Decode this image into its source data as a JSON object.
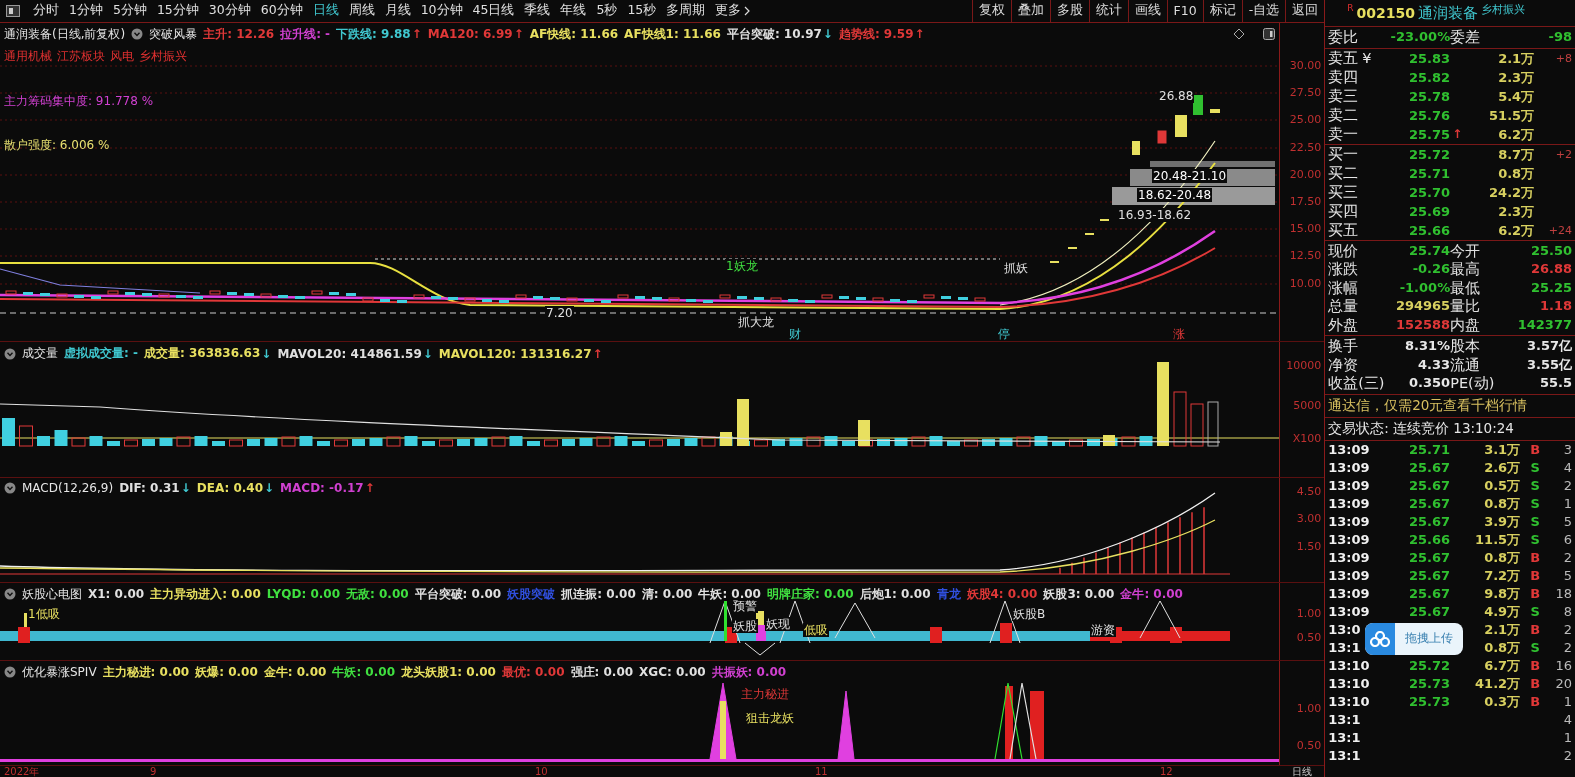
{
  "toolbar": {
    "periods": [
      {
        "label": "分时",
        "selected": false
      },
      {
        "label": "1分钟",
        "selected": false
      },
      {
        "label": "5分钟",
        "selected": false
      },
      {
        "label": "15分钟",
        "selected": false
      },
      {
        "label": "30分钟",
        "selected": false
      },
      {
        "label": "60分钟",
        "selected": false
      },
      {
        "label": "日线",
        "selected": true
      },
      {
        "label": "周线",
        "selected": false
      },
      {
        "label": "月线",
        "selected": false
      },
      {
        "label": "10分钟",
        "selected": false
      },
      {
        "label": "45日线",
        "selected": false
      },
      {
        "label": "季线",
        "selected": false
      },
      {
        "label": "年线",
        "selected": false
      },
      {
        "label": "5秒",
        "selected": false
      },
      {
        "label": "15秒",
        "selected": false
      },
      {
        "label": "多周期",
        "selected": false
      }
    ],
    "more": "更多",
    "actions": [
      "复权",
      "叠加",
      "多股",
      "统计",
      "画线",
      "F10",
      "标记",
      "-自选",
      "返回"
    ]
  },
  "panels": [
    {
      "kind": "price",
      "title": "通润装备(日线,前复权)",
      "indicator": "突破风暴",
      "items": [
        {
          "text": "主升: 12.26",
          "color": "#e03838"
        },
        {
          "text": "拉升线: -",
          "color": "#d040d0"
        },
        {
          "text": "下跌线: 9.88",
          "color": "#40c8d0",
          "arrow": "↑",
          "rising": true
        },
        {
          "text": "MA120: 6.99",
          "color": "#e03838",
          "arrow": "↑",
          "rising": true
        },
        {
          "text": "AF快线: 11.66",
          "color": "#e8e060"
        },
        {
          "text": "AF快线1: 11.66",
          "color": "#e8e060"
        },
        {
          "text": "平台突破: 10.97",
          "color": "#e0e0e0",
          "arrow": "↓",
          "rising": false
        },
        {
          "text": "趋势线: 9.59",
          "color": "#e03838",
          "arrow": "↑",
          "rising": true
        }
      ],
      "tags": [
        "通用机械",
        "江苏板块",
        "风电",
        "乡村振兴"
      ],
      "notes": [
        {
          "text": "主力筹码集中度: 91.778  %",
          "color": "#d040d0"
        },
        {
          "text": "散户强度: 6.006 %",
          "color": "#e8e070"
        }
      ],
      "axis": [
        "30.00",
        "27.50",
        "25.00",
        "22.50",
        "20.00",
        "17.50",
        "15.00",
        "12.50",
        "10.00"
      ],
      "annotations": [
        "26.88",
        "20.48-21.10",
        "18.62-20.48",
        "16.93-18.62",
        "7.20",
        "1妖龙",
        "抓妖",
        "抓大龙",
        "财",
        "停",
        "涨"
      ]
    },
    {
      "kind": "volume",
      "title": "成交量",
      "items": [
        {
          "text": "虚拟成交量: -",
          "color": "#40c8d0"
        },
        {
          "text": "成交量: 363836.63",
          "color": "#e8e060",
          "arrow": "↓",
          "rising": false
        },
        {
          "text": "MAVOL20: 414861.59",
          "color": "#e0e0e0",
          "arrow": "↓",
          "rising": false
        },
        {
          "text": "MAVOL120: 131316.27",
          "color": "#e8e060",
          "arrow": "↑",
          "rising": true
        }
      ],
      "axis": [
        "10000",
        "5000",
        "X100"
      ]
    },
    {
      "kind": "macd",
      "title": "MACD(12,26,9)",
      "items": [
        {
          "text": "DIF: 0.31",
          "color": "#e0e0e0",
          "arrow": "↓",
          "rising": false
        },
        {
          "text": "DEA: 0.40",
          "color": "#e8e060",
          "arrow": "↓",
          "rising": false
        },
        {
          "text": "MACD: -0.17",
          "color": "#d040d0",
          "arrow": "↑",
          "rising": true
        }
      ],
      "axis": [
        "4.50",
        "3.00",
        "1.50"
      ]
    },
    {
      "kind": "signal",
      "title": "妖股心电图",
      "items": [
        {
          "text": "X1: 0.00",
          "color": "#e0e0e0"
        },
        {
          "text": "主力异动进入: 0.00",
          "color": "#e8e060"
        },
        {
          "text": "LYQD: 0.00",
          "color": "#40e040"
        },
        {
          "text": "无敌: 0.00",
          "color": "#40e040"
        },
        {
          "text": "平台突破: 0.00",
          "color": "#e0e0e0"
        },
        {
          "text": "妖股突破",
          "color": "#3050e0"
        },
        {
          "text": "抓连振: 0.00",
          "color": "#e0e0e0"
        },
        {
          "text": "清: 0.00",
          "color": "#e0e0e0"
        },
        {
          "text": "牛妖: 0.00",
          "color": "#e0e0e0"
        },
        {
          "text": "明牌庄家: 0.00",
          "color": "#40e040"
        },
        {
          "text": "后炮1: 0.00",
          "color": "#e0e0e0"
        },
        {
          "text": "青龙",
          "color": "#3050e0"
        },
        {
          "text": "妖股4: 0.00",
          "color": "#e03838"
        },
        {
          "text": "妖股3: 0.00",
          "color": "#e0e0e0"
        },
        {
          "text": "金牛: 0.00",
          "color": "#d040d0"
        }
      ],
      "axis": [
        "1.00",
        "0.50"
      ],
      "annotations": [
        "1低吸",
        "预警",
        "妖股",
        "妖现",
        "低吸",
        "游资",
        "妖股B"
      ]
    },
    {
      "kind": "spiv",
      "title": "优化暴涨SPIV",
      "items": [
        {
          "text": "主力秘进: 0.00",
          "color": "#e8e060"
        },
        {
          "text": "妖爆: 0.00",
          "color": "#e8e060"
        },
        {
          "text": "金牛: 0.00",
          "color": "#e8e060"
        },
        {
          "text": "牛妖: 0.00",
          "color": "#40e040"
        },
        {
          "text": "龙头妖股1: 0.00",
          "color": "#e8e060"
        },
        {
          "text": "最优: 0.00",
          "color": "#e03838"
        },
        {
          "text": "强庄: 0.00",
          "color": "#e0e0e0"
        },
        {
          "text": "XGC: 0.00",
          "color": "#e0e0e0"
        },
        {
          "text": "共振妖: 0.00",
          "color": "#d040d0"
        }
      ],
      "axis": [
        "1.00",
        "0.50"
      ],
      "annotations": [
        "主力秘进",
        "狙击龙妖"
      ]
    }
  ],
  "date_axis": [
    "2022年",
    "9",
    "10",
    "11",
    "12"
  ],
  "period_label": "日线",
  "quote": {
    "market_tag": "R",
    "code": "002150",
    "name": "通润装备",
    "concept": "乡村振兴",
    "ratio": [
      "委比",
      "-23.00%",
      "委差",
      "-98"
    ],
    "asks": [
      {
        "label": "卖五",
        "flag": "¥",
        "price": "25.83",
        "volume": "2.1万",
        "change": "+8"
      },
      {
        "label": "卖四",
        "price": "25.82",
        "volume": "2.3万"
      },
      {
        "label": "卖三",
        "price": "25.78",
        "volume": "5.4万"
      },
      {
        "label": "卖二",
        "price": "25.76",
        "volume": "51.5万"
      },
      {
        "label": "卖一",
        "price": "25.75",
        "arrow": "↑",
        "volume": "6.2万"
      }
    ],
    "bids": [
      {
        "label": "买一",
        "price": "25.72",
        "volume": "8.7万",
        "change": "+2"
      },
      {
        "label": "买二",
        "price": "25.71",
        "volume": "0.8万"
      },
      {
        "label": "买三",
        "price": "25.70",
        "volume": "24.2万"
      },
      {
        "label": "买四",
        "price": "25.69",
        "volume": "2.3万"
      },
      {
        "label": "买五",
        "price": "25.66",
        "volume": "6.2万",
        "change": "+24"
      }
    ],
    "stats": [
      {
        "text": "现价",
        "color": "#e0e0e0"
      },
      {
        "text": "25.74",
        "color": "#30c030"
      },
      {
        "text": "今开",
        "color": "#e0e0e0"
      },
      {
        "text": "25.50",
        "color": "#30c030"
      },
      {
        "text": "涨跌",
        "color": "#e0e0e0"
      },
      {
        "text": "-0.26",
        "color": "#30c030"
      },
      {
        "text": "最高",
        "color": "#e0e0e0"
      },
      {
        "text": "26.88",
        "color": "#e03838"
      },
      {
        "text": "涨幅",
        "color": "#e0e0e0"
      },
      {
        "text": "-1.00%",
        "color": "#30c030"
      },
      {
        "text": "最低",
        "color": "#e0e0e0"
      },
      {
        "text": "25.25",
        "color": "#30c030"
      },
      {
        "text": "总量",
        "color": "#e0e0e0"
      },
      {
        "text": "294965",
        "color": "#d8d060"
      },
      {
        "text": "量比",
        "color": "#e0e0e0"
      },
      {
        "text": "1.18",
        "color": "#e03838"
      },
      {
        "text": "外盘",
        "color": "#e0e0e0"
      },
      {
        "text": "152588",
        "color": "#e03838"
      },
      {
        "text": "内盘",
        "color": "#e0e0e0"
      },
      {
        "text": "142377",
        "color": "#30c030"
      }
    ],
    "fundamentals": [
      "换手",
      "8.31%",
      "股本",
      "3.57亿",
      "净资",
      "4.33",
      "流通",
      "3.55亿",
      "收益(三)",
      "0.350",
      "PE(动)",
      "55.5"
    ],
    "ad": "通达信，仅需20元查看千档行情",
    "trade_status": "交易状态: 连续竞价 13:10:24",
    "trades": [
      {
        "time": "13:09",
        "price": "25.71",
        "volume": "3.1万",
        "side": "B",
        "count": "3"
      },
      {
        "time": "13:09",
        "price": "25.67",
        "volume": "2.6万",
        "side": "S",
        "count": "4"
      },
      {
        "time": "13:09",
        "price": "25.67",
        "volume": "0.5万",
        "side": "S",
        "count": "2"
      },
      {
        "time": "13:09",
        "price": "25.67",
        "volume": "0.8万",
        "side": "S",
        "count": "1"
      },
      {
        "time": "13:09",
        "price": "25.67",
        "volume": "3.9万",
        "side": "S",
        "count": "5"
      },
      {
        "time": "13:09",
        "price": "25.66",
        "volume": "11.5万",
        "side": "S",
        "count": "6"
      },
      {
        "time": "13:09",
        "price": "25.67",
        "volume": "0.8万",
        "side": "B",
        "count": "2"
      },
      {
        "time": "13:09",
        "price": "25.67",
        "volume": "7.2万",
        "side": "B",
        "count": "5"
      },
      {
        "time": "13:09",
        "price": "25.67",
        "volume": "9.8万",
        "side": "B",
        "count": "18"
      },
      {
        "time": "13:09",
        "price": "25.67",
        "volume": "4.9万",
        "side": "S",
        "count": "8"
      },
      {
        "time": "13:0",
        "volume": "2.1万",
        "side": "B",
        "count": "2"
      },
      {
        "time": "13:1",
        "volume": "0.8万",
        "side": "S",
        "count": "2"
      },
      {
        "time": "13:10",
        "price": "25.72",
        "volume": "6.7万",
        "side": "B",
        "count": "16"
      },
      {
        "time": "13:10",
        "price": "25.73",
        "volume": "41.2万",
        "side": "B",
        "count": "20"
      },
      {
        "time": "13:10",
        "price": "25.73",
        "volume": "0.3万",
        "side": "B",
        "count": "1"
      },
      {
        "time": "13:1",
        "count": "4"
      },
      {
        "time": "13:1",
        "count": "1"
      },
      {
        "time": "13:1",
        "count": "2"
      }
    ]
  },
  "upload_widget": {
    "label": "拖拽上传"
  }
}
